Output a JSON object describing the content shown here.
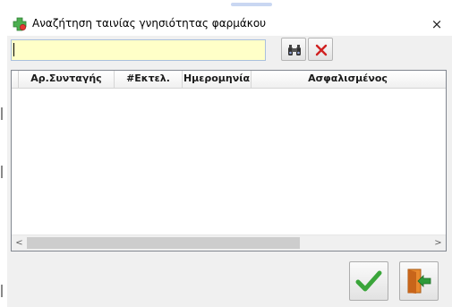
{
  "window": {
    "title": "Αναζήτηση ταινίας γνησιότητας φαρμάκου",
    "close_glyph": "×",
    "app_icon": "pharmacy-cross-icon"
  },
  "search": {
    "value": "",
    "find_icon": "binoculars-icon",
    "clear_icon": "red-x-icon"
  },
  "grid": {
    "columns": [
      "Αρ.Συνταγής",
      "#Εκτελ.",
      "Ημερομηνία",
      "Ασφαλισμένος"
    ],
    "rows": [],
    "scroll_left_glyph": "<",
    "scroll_right_glyph": ">"
  },
  "actions": {
    "ok_icon": "green-check-icon",
    "exit_icon": "exit-door-icon"
  },
  "colors": {
    "search_bg": "#ffffc8",
    "ok_green": "#3aa53a",
    "clear_red": "#d02020",
    "exit_orange": "#d97a20"
  }
}
